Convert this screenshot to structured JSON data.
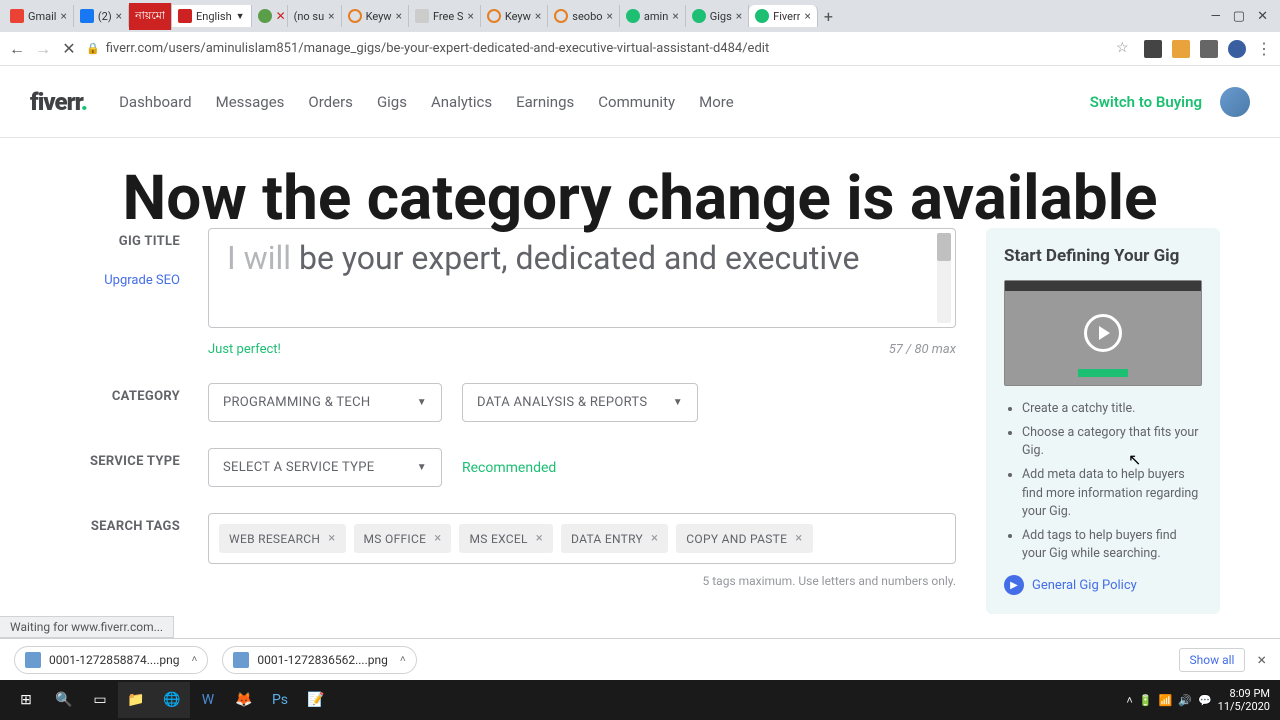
{
  "browser": {
    "tabs": [
      {
        "label": "Gmail"
      },
      {
        "label": "(2)"
      },
      {
        "label": "নায়মো"
      },
      {
        "label": "English"
      },
      {
        "label": "(no su"
      },
      {
        "label": "Keyw"
      },
      {
        "label": "Free S"
      },
      {
        "label": "Keyw"
      },
      {
        "label": "seobo"
      },
      {
        "label": "amin"
      },
      {
        "label": "Gigs"
      },
      {
        "label": "Fiverr"
      }
    ],
    "url": "fiverr.com/users/aminulislam851/manage_gigs/be-your-expert-dedicated-and-executive-virtual-assistant-d484/edit",
    "status": "Waiting for www.fiverr.com..."
  },
  "header": {
    "logo": "fiverr",
    "nav": [
      "Dashboard",
      "Messages",
      "Orders",
      "Gigs",
      "Analytics",
      "Earnings",
      "Community",
      "More"
    ],
    "switch": "Switch to Buying"
  },
  "overlay": "Now the category change is available",
  "form": {
    "title_label": "GIG TITLE",
    "upgrade": "Upgrade SEO",
    "title_prefix": "I will ",
    "title_value": "be your expert, dedicated and executive",
    "validation": "Just perfect!",
    "counter": "57 / 80 max",
    "category_label": "CATEGORY",
    "category1": "PROGRAMMING & TECH",
    "category2": "DATA ANALYSIS & REPORTS",
    "service_label": "SERVICE TYPE",
    "service_value": "SELECT A SERVICE TYPE",
    "recommended": "Recommended",
    "tags_label": "SEARCH TAGS",
    "tags": [
      "WEB RESEARCH",
      "MS OFFICE",
      "MS EXCEL",
      "DATA ENTRY",
      "COPY AND PASTE"
    ],
    "tags_hint": "5 tags maximum. Use letters and numbers only."
  },
  "sidebar": {
    "title": "Start Defining Your Gig",
    "tips": [
      "Create a catchy title.",
      "Choose a category that fits your Gig.",
      "Add meta data to help buyers find more information regarding your Gig.",
      "Add tags to help buyers find your Gig while searching."
    ],
    "policy": "General Gig Policy"
  },
  "downloads": {
    "files": [
      "0001-1272858874....png",
      "0001-1272836562....png"
    ],
    "show_all": "Show all"
  },
  "taskbar": {
    "time": "8:09 PM",
    "date": "11/5/2020"
  }
}
